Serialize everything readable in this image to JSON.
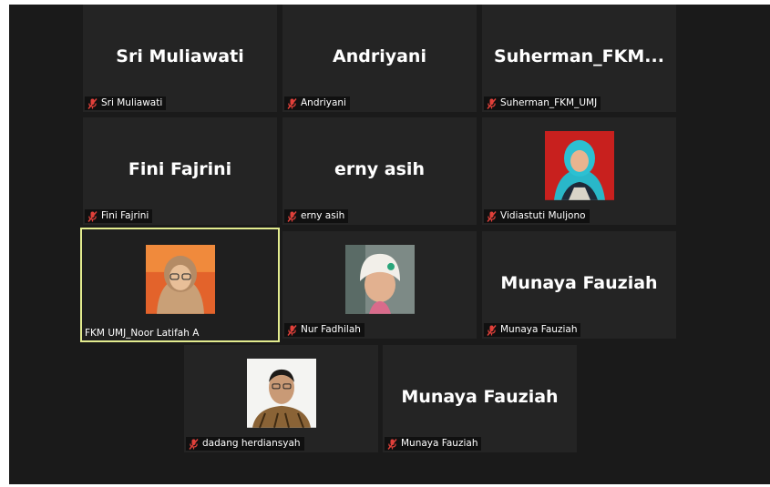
{
  "participants": [
    {
      "display": "Sri Muliawati",
      "label": "Sri Muliawati",
      "muted": true
    },
    {
      "display": "Andriyani",
      "label": "Andriyani",
      "muted": true
    },
    {
      "display": "Suherman_FKM...",
      "label": "Suherman_FKM_UMJ",
      "muted": true
    },
    {
      "display": "Fini Fajrini",
      "label": "Fini Fajrini",
      "muted": true
    },
    {
      "display": "erny asih",
      "label": "erny asih",
      "muted": true
    },
    {
      "label": "Vidiastuti Muljono",
      "muted": true,
      "photo": "woman-turquoise-hijab-avatar"
    },
    {
      "label": "FKM UMJ_Noor Latifah A",
      "muted": false,
      "active_speaker": true,
      "photo": "woman-glasses-hijab-avatar"
    },
    {
      "label": "Nur Fadhilah",
      "muted": true,
      "photo": "woman-white-beanie-avatar"
    },
    {
      "display": "Munaya Fauziah",
      "label": "Munaya Fauziah",
      "muted": true
    },
    {
      "label": "dadang herdiansyah",
      "muted": true,
      "photo": "man-batik-shirt-avatar"
    },
    {
      "display": "Munaya Fauziah",
      "label": "Munaya Fauziah",
      "muted": true
    }
  ],
  "colors": {
    "background": "#1a1a1a",
    "tile": "#242424",
    "active_border": "#e3ec8f",
    "muted_icon": "#e0403a"
  }
}
